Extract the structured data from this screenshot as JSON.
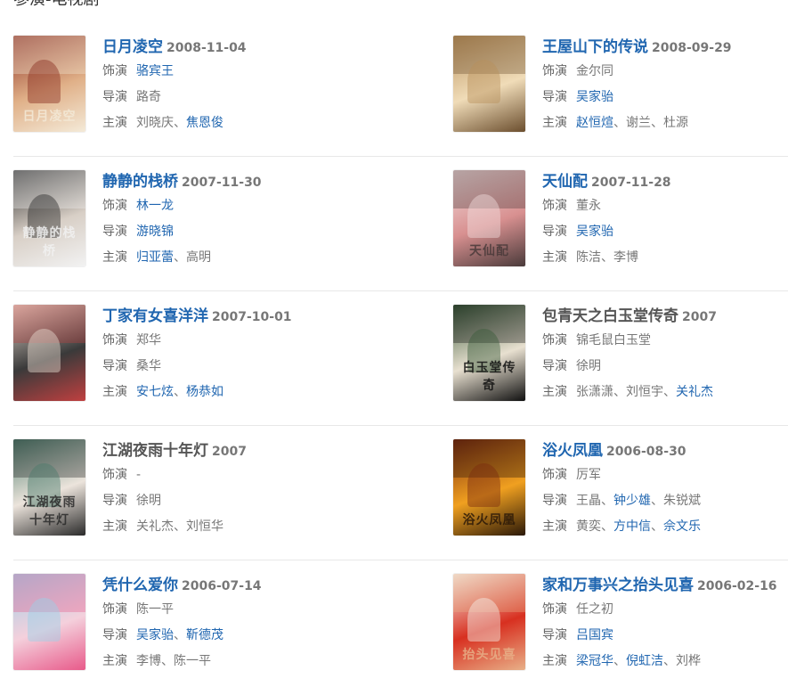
{
  "section_title": "参演-电视剧",
  "field_labels": {
    "role": "饰演",
    "director": "导演",
    "cast": "主演"
  },
  "rows": [
    [
      {
        "title": "日月凌空",
        "title_link": true,
        "year": "2008-11-04",
        "poster": {
          "c1": "#8a2e22",
          "c2": "#e0b088",
          "c3": "#f4ead8",
          "caption": "日月凌空"
        },
        "role": [
          {
            "name": "骆宾王",
            "link": true
          }
        ],
        "director": [
          {
            "name": "路奇",
            "link": false
          }
        ],
        "cast": [
          {
            "name": "刘晓庆",
            "link": false
          },
          {
            "name": "焦恩俊",
            "link": true
          }
        ]
      },
      {
        "title": "王屋山下的传说",
        "title_link": true,
        "year": "2008-09-29",
        "poster": {
          "c1": "#b8905c",
          "c2": "#f0dcb8",
          "c3": "#6b4e2e",
          "caption": ""
        },
        "role": [
          {
            "name": "金尔同",
            "link": false
          }
        ],
        "director": [
          {
            "name": "吴家骀",
            "link": true
          }
        ],
        "cast": [
          {
            "name": "赵恒煊",
            "link": true
          },
          {
            "name": "谢兰",
            "link": false
          },
          {
            "name": "杜源",
            "link": false
          }
        ]
      }
    ],
    [
      {
        "title": "静静的栈桥",
        "title_link": true,
        "year": "2007-11-30",
        "poster": {
          "c1": "#2a2a2a",
          "c2": "#d8cfc6",
          "c3": "#f2f2f2",
          "caption": "静静的栈桥"
        },
        "role": [
          {
            "name": "林一龙",
            "link": true
          }
        ],
        "director": [
          {
            "name": "游晓锦",
            "link": true
          }
        ],
        "cast": [
          {
            "name": "归亚蕾",
            "link": true
          },
          {
            "name": "高明",
            "link": false
          }
        ]
      },
      {
        "title": "天仙配",
        "title_link": true,
        "year": "2007-11-28",
        "poster": {
          "c1": "#f2dede",
          "c2": "#d89090",
          "c3": "#4a3a3a",
          "caption": "天仙配"
        },
        "role": [
          {
            "name": "董永",
            "link": false
          }
        ],
        "director": [
          {
            "name": "吴家骀",
            "link": true
          }
        ],
        "cast": [
          {
            "name": "陈洁",
            "link": false
          },
          {
            "name": "李博",
            "link": false
          }
        ]
      }
    ],
    [
      {
        "title": "丁家有女喜洋洋",
        "title_link": true,
        "year": "2007-10-01",
        "poster": {
          "c1": "#e8dcd0",
          "c2": "#3a3a3a",
          "c3": "#c04040",
          "caption": ""
        },
        "role": [
          {
            "name": "郑华",
            "link": false
          }
        ],
        "director": [
          {
            "name": "桑华",
            "link": false
          }
        ],
        "cast": [
          {
            "name": "安七炫",
            "link": true
          },
          {
            "name": "杨恭如",
            "link": true
          }
        ]
      },
      {
        "title": "包青天之白玉堂传奇",
        "title_link": false,
        "year": "2007",
        "poster": {
          "c1": "#3a5a3a",
          "c2": "#e8e0d0",
          "c3": "#101010",
          "caption": "白玉堂传奇"
        },
        "role": [
          {
            "name": "锦毛鼠白玉堂",
            "link": false
          }
        ],
        "director": [
          {
            "name": "徐明",
            "link": false
          }
        ],
        "cast": [
          {
            "name": "张潇潇",
            "link": false
          },
          {
            "name": "刘恒宇",
            "link": false
          },
          {
            "name": "关礼杰",
            "link": true
          }
        ]
      }
    ],
    [
      {
        "title": "江湖夜雨十年灯",
        "title_link": false,
        "year": "2007",
        "poster": {
          "c1": "#4a7a6a",
          "c2": "#ece4dc",
          "c3": "#2a2a2a",
          "caption": "江湖夜雨十年灯"
        },
        "role": [
          {
            "name": "-",
            "link": false
          }
        ],
        "director": [
          {
            "name": "徐明",
            "link": false
          }
        ],
        "cast": [
          {
            "name": "关礼杰",
            "link": false
          },
          {
            "name": "刘恒华",
            "link": false
          }
        ]
      },
      {
        "title": "浴火凤凰",
        "title_link": true,
        "year": "2006-08-30",
        "poster": {
          "c1": "#7a2a10",
          "c2": "#f0a020",
          "c3": "#2a1808",
          "caption": "浴火凤凰"
        },
        "role": [
          {
            "name": "厉军",
            "link": false
          }
        ],
        "director": [
          {
            "name": "王晶",
            "link": false
          },
          {
            "name": "钟少雄",
            "link": true
          },
          {
            "name": "朱锐斌",
            "link": false
          }
        ],
        "cast": [
          {
            "name": "黄奕",
            "link": false
          },
          {
            "name": "方中信",
            "link": true
          },
          {
            "name": "佘文乐",
            "link": true
          }
        ]
      }
    ],
    [
      {
        "title": "凭什么爱你",
        "title_link": true,
        "year": "2006-07-14",
        "poster": {
          "c1": "#9ad0e8",
          "c2": "#f4d0dc",
          "c3": "#e85a8a",
          "caption": ""
        },
        "role": [
          {
            "name": "陈一平",
            "link": false
          }
        ],
        "director": [
          {
            "name": "吴家骀",
            "link": true
          },
          {
            "name": "靳德茂",
            "link": true
          }
        ],
        "cast": [
          {
            "name": "李博",
            "link": false
          },
          {
            "name": "陈一平",
            "link": false
          }
        ]
      },
      {
        "title": "家和万事兴之抬头见喜",
        "title_link": true,
        "year": "2006-02-16",
        "poster": {
          "c1": "#f4f0e8",
          "c2": "#d83020",
          "c3": "#e8b088",
          "caption": "抬头见喜"
        },
        "role": [
          {
            "name": "任之初",
            "link": false
          }
        ],
        "director": [
          {
            "name": "吕国宾",
            "link": true
          }
        ],
        "cast": [
          {
            "name": "梁冠华",
            "link": true
          },
          {
            "name": "倪虹洁",
            "link": true
          },
          {
            "name": "刘桦",
            "link": false
          }
        ]
      }
    ]
  ]
}
